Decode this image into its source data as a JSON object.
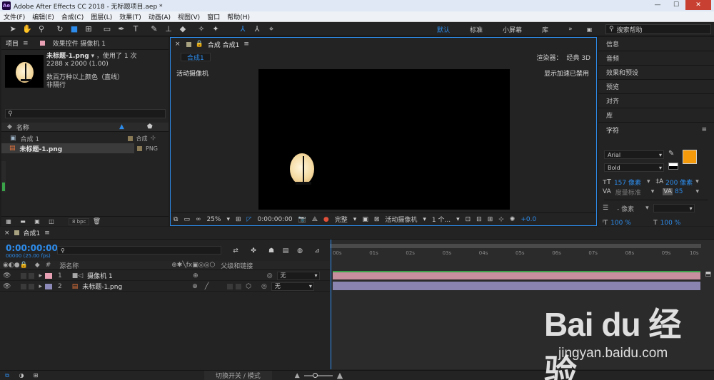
{
  "window": {
    "title": "Adobe After Effects CC 2018 - 无标题项目.aep *",
    "app_badge": "Ae"
  },
  "menu": [
    "文件(F)",
    "编辑(E)",
    "合成(C)",
    "图层(L)",
    "效果(T)",
    "动画(A)",
    "视图(V)",
    "窗口",
    "帮助(H)"
  ],
  "workspaces": {
    "items": [
      "默认",
      "标准",
      "小屏幕",
      "库"
    ],
    "active": "默认",
    "more": "»",
    "search_placeholder": "搜索帮助"
  },
  "project": {
    "tab_label": "项目",
    "effects_tab_label": "效果控件 摄像机 1",
    "file_name": "未标题-1.png",
    "used_count": "，使用了 1 次",
    "dimensions": "2288 x 2000 (1.00)",
    "colors": "数百万种以上颜色（直线）",
    "interlace": "非隔行",
    "column_name": "名称",
    "items": [
      {
        "name": "合成 1",
        "type": "合成",
        "color": "#8a7a55"
      },
      {
        "name": "未标题-1.png",
        "type": "PNG",
        "color": "#8a7a55"
      }
    ],
    "bpc": "8 bpc"
  },
  "composition": {
    "tab_label": "合成 合成1",
    "sub_tab": "合成1",
    "renderer_label": "渲染器：",
    "renderer_value": "经典 3D",
    "active_camera": "活动摄像机",
    "accel_msg": "显示加速已禁用",
    "zoom": "25%",
    "timecode": "0:00:00:00",
    "resolution": "完整",
    "camera_view": "活动摄像机",
    "views": "1 个...",
    "exposure": "+0.0"
  },
  "right_panel": {
    "items": [
      "信息",
      "音频",
      "效果和预设",
      "预览",
      "对齐",
      "库"
    ],
    "character_label": "字符",
    "font_family": "Arial",
    "font_style": "Bold",
    "font_size": "157 像素",
    "leading": "200 像素",
    "kerning": "度量标准",
    "tracking": "85",
    "stroke_width": "- 像素",
    "scale_v": "100 %",
    "scale_h": "100 %",
    "fill_color": "#f59a0a"
  },
  "timeline": {
    "tab_label": "合成1",
    "timecode": "0:00:00:00",
    "fps": "00000 (25.00 fps)",
    "col_source": "源名称",
    "col_parent": "父级和链接",
    "ticks": [
      "00s",
      "01s",
      "02s",
      "03s",
      "04s",
      "05s",
      "06s",
      "07s",
      "08s",
      "09s",
      "10s"
    ],
    "layers": [
      {
        "num": "1",
        "name": "摄像机 1",
        "parent": "无",
        "color": "#e8a0b4",
        "bar": "#c88f9f"
      },
      {
        "num": "2",
        "name": "未标题-1.png",
        "parent": "无",
        "color": "#8c88b8",
        "bar": "#8985b0"
      }
    ],
    "toggle_label": "切换开关 / 模式"
  },
  "watermark": {
    "logo": "Bai du 经验",
    "url": "jingyan.baidu.com"
  }
}
